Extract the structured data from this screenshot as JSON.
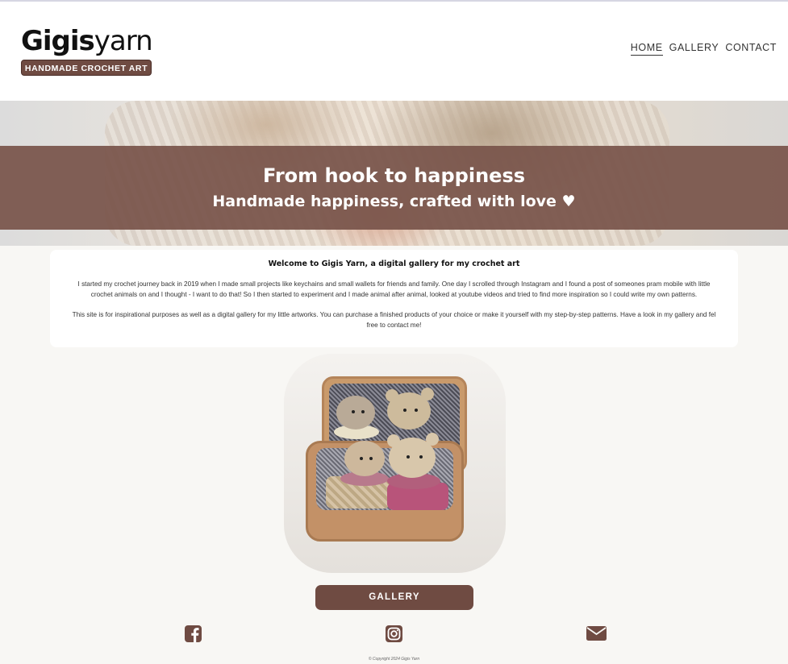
{
  "brand": {
    "logo_bold": "Gigis",
    "logo_light": "yarn",
    "tagline": "HANDMADE CROCHET ART"
  },
  "nav": {
    "items": [
      {
        "label": "HOME",
        "active": true
      },
      {
        "label": "GALLERY",
        "active": false
      },
      {
        "label": "CONTACT",
        "active": false
      }
    ]
  },
  "hero": {
    "title": "From hook to happiness",
    "subtitle": "Handmade happiness, crafted with love ♥"
  },
  "welcome": {
    "heading": "Welcome to Gigis Yarn, a digital gallery for my crochet art",
    "paragraph1": "I started my crochet journey back in 2019 when I made small projects like keychains and small wallets for friends and family. One day I scrolled through Instagram and I found a post of someones pram mobile with little crochet animals on and I thought - I want to do that! So I then started to experiment and I made animal after animal, looked at youtube videos and tried to find more inspiration so I could write my own patterns.",
    "paragraph2": "This site is for inspirational purposes as well as a digital gallery for my little artworks. You can purchase a finished products of your choice or make it yourself with my step-by-step patterns. Have a look in my gallery and fel free to contact me!"
  },
  "cta": {
    "gallery_label": "GALLERY"
  },
  "social": {
    "icons": [
      "facebook-icon",
      "instagram-icon",
      "envelope-icon"
    ],
    "color": "#6f4b42"
  },
  "footer": {
    "copyright": "© Copyright 2024 Gigis Yarn"
  },
  "colors": {
    "accent": "#6f4b42",
    "hero_band": "#78544a",
    "background": "#f8f7f4"
  }
}
